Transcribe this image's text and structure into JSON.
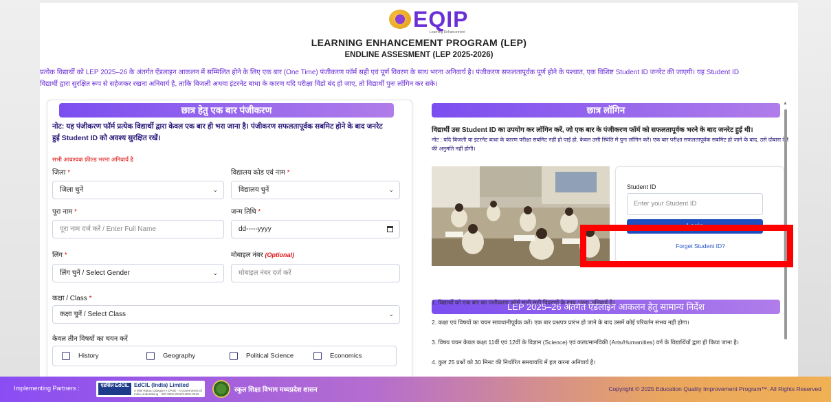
{
  "header": {
    "logo_text": "EQIP",
    "logo_sub": "Learning Enhancement",
    "title": "LEARNING ENHANCEMENT PROGRAM (LEP)",
    "subtitle": "ENDLINE ASSESMENT (LEP 2025-2026)",
    "intro_line1": "प्रत्येक विद्यार्थी को LEP 2025–26 के अंतर्गत ऐंडलाइन आकलन में सम्मिलित होने के लिए एक बार (One Time) पंजीकरण फॉर्म सही एवं पूर्ण विवरण के साथ भरना अनिवार्य है। पंजीकरण सफलतापूर्वक पूर्ण होने के पश्चात, एक विशिष्ट Student ID जनरेट की जाएगी। यह Student ID",
    "intro_line2": "विद्यार्थी द्वारा सुरक्षित रूप से सहेजकर रखना अनिवार्य है, ताकि बिजली अथवा इंटरनेट बाधा के कारण यदि परीक्षा विंडो बंद हो जाए, तो विद्यार्थी पुनः लॉगिन कर सके।"
  },
  "registration": {
    "heading": "छात्र हेतु एक बार पंजीकरण",
    "note": "नोट: यह पंजीकरण फॉर्म प्रत्येक विद्यार्थी द्वारा केवल एक बार ही भरा जाना है। पंजीकरण सफलतापूर्वक सबमिट होने के बाद जनरेट हुई Student ID को अवश्य सुरक्षित रखें।",
    "required_note": "सभी आवश्यक फ़ील्ड भरना अनिवार्य है",
    "district_label": "जिला",
    "district_value": "जिला चुनें",
    "school_label": "विद्यालय कोड एवं नाम",
    "school_value": "विद्यालय चुनें",
    "name_label": "पूरा नाम",
    "name_placeholder": "पूरा नाम दर्ज करें / Enter Full Name",
    "dob_label": "जन्म तिथि",
    "dob_value": "dd-----yyyy",
    "gender_label": "लिंग",
    "gender_value": "लिंग चुनें / Select Gender",
    "mobile_label": "मोबाइल नंबर",
    "mobile_optional": "(Optional)",
    "mobile_placeholder": "मोबाइल नंबर दर्ज करें",
    "class_label": "कक्षा / Class",
    "class_value": "कक्षा चुनें / Select Class",
    "subjects_label": "केवल तीन विषयों का चयन करें",
    "subjects": [
      "History",
      "Geography",
      "Political Science",
      "Economics"
    ],
    "required_mark": "*"
  },
  "login": {
    "heading": "छात्र लॉगिन",
    "note_bold": "विद्यार्थी उस Student ID का उपयोग कर लॉगिन करें, जो एक बार के पंजीकरण फॉर्म को सफलतापूर्वक भरने के बाद जनरेट हुई थी।",
    "note_small": "नोट : यदि बिजली या इंटरनेट बाधा के कारण परीक्षा सबमिट नहीं हो पाई हो, केवल उसी स्थिति में पुनः लॉगिन करें। एक बार परीक्षा सफलतापूर्वक सबमिट हो जाने के बाद, उसे दोबारा देने की अनुमति नहीं होगी।",
    "student_id_label": "Student ID",
    "student_id_placeholder": "Enter your Student ID",
    "login_button": "Login",
    "forget_link": "Forget Student ID?"
  },
  "instructions": {
    "heading": "LEP 2025–26 अंतर्गत ऐंडलाइन आकलन हेतु सामान्य निर्देश",
    "items": [
      "1.  विद्यार्थी को एक बार का पंजीकरण फॉर्म सभी सही विवरणों के साथ भरना अनिवार्य है।",
      "2.  कक्षा एवं विषयों का चयन सावधानीपूर्वक करें। एक बार प्रश्नपत्र प्रारंभ हो जाने के बाद उसमें कोई परिवर्तन संभव नहीं होगा।",
      "3.  विषय चयन केवल कक्षा 11वीं एवं 12वीं के विज्ञान (Science) एवं कला/मानविकी (Arts/Humanities) वर्ग के विद्यार्थियों द्वारा ही किया जाना है।",
      "4.  कुल 25 प्रश्नों को 30 मिनट की निर्धारित समयावधि में हल करना अनिवार्य है।"
    ]
  },
  "footer": {
    "partners_label": "Implementing Partners :",
    "edcil_badge": "एडसिल EdCIL",
    "edcil_name": "EdCIL (India) Limited",
    "edcil_sub": "A Mini Ratna Category-I CPSE · A Government of India Undertaking · ISO 9001:2015/14001:2015",
    "mp_dept": "स्कूल शिक्षा विभाग मध्यप्रदेश शासन",
    "copyright": "Copyright © 2025 Education Quality Improvement Program™. All Rights Reserved"
  },
  "colors": {
    "accent_purple": "#7b4ef0",
    "link_blue": "#2456c7",
    "login_button": "#1e4fc0",
    "highlight_red": "#ff0000"
  }
}
